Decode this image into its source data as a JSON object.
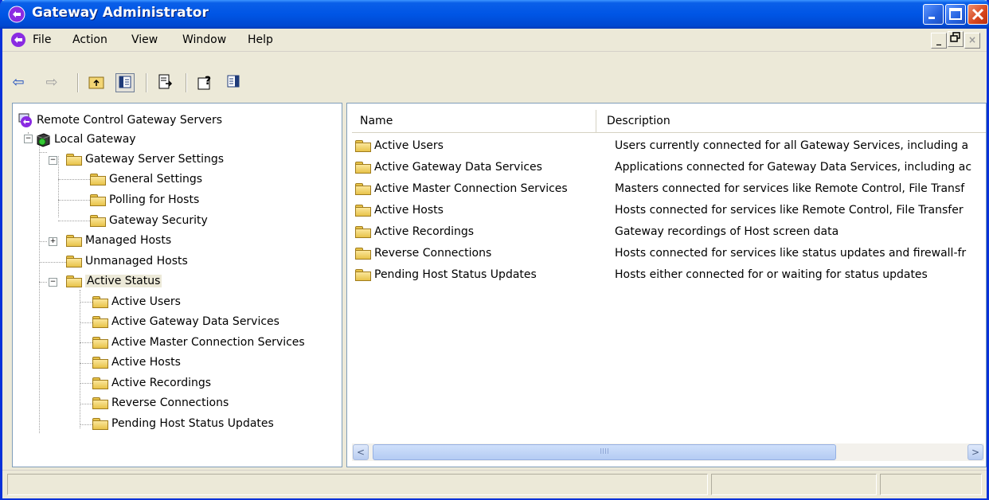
{
  "window": {
    "title": "Gateway Administrator"
  },
  "menu": {
    "items": [
      "File",
      "Action",
      "View",
      "Window",
      "Help"
    ]
  },
  "mdi": {
    "minimize": "_",
    "restore": "͡",
    "close": "×"
  },
  "toolbar": {
    "back": "⇦",
    "forward": "⇨",
    "up": "⬑",
    "show_hide_tree": "▤",
    "export": "⎘",
    "help": "?",
    "properties": "▦"
  },
  "tree": {
    "root": "Remote Control Gateway Servers",
    "local_gateway": "Local Gateway",
    "gateway_server_settings": "Gateway Server Settings",
    "settings_children": [
      "General Settings",
      "Polling for Hosts",
      "Gateway Security"
    ],
    "managed_hosts": "Managed Hosts",
    "unmanaged_hosts": "Unmanaged Hosts",
    "active_status": "Active Status",
    "status_children": [
      "Active Users",
      "Active Gateway Data Services",
      "Active Master Connection Services",
      "Active Hosts",
      "Active Recordings",
      "Reverse Connections",
      "Pending Host Status Updates"
    ]
  },
  "list": {
    "columns": {
      "name": "Name",
      "description": "Description"
    },
    "rows": [
      {
        "name": "Active Users",
        "description": "Users currently connected for all Gateway Services, including a"
      },
      {
        "name": "Active Gateway Data Services",
        "description": "Applications connected for Gateway Data Services, including ac"
      },
      {
        "name": "Active Master Connection Services",
        "description": "Masters connected for services like Remote Control, File Transf"
      },
      {
        "name": "Active Hosts",
        "description": "Hosts connected for services like Remote Control, File Transfer"
      },
      {
        "name": "Active Recordings",
        "description": "Gateway recordings of Host screen data"
      },
      {
        "name": "Reverse Connections",
        "description": "Hosts connected for services like status updates and firewall-fr"
      },
      {
        "name": "Pending Host Status Updates",
        "description": "Hosts either connected for or waiting for status updates"
      }
    ]
  },
  "scrollbar": {
    "left": "<",
    "right": ">",
    "grip": "IIII"
  },
  "colors": {
    "titlebar": "#0055e5",
    "selection": "#ece9d8",
    "border": "#7f9db9"
  }
}
